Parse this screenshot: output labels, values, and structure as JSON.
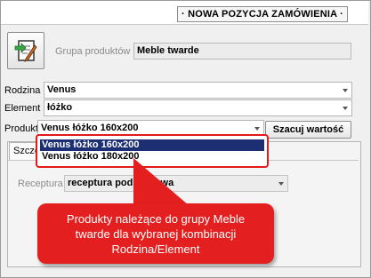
{
  "header": {
    "title_button_label": "· NOWA POZYCJA ZAMÓWIENIA ·"
  },
  "form": {
    "edit_icon_name": "edit-document-icon",
    "grupa_label": "Grupa produktów",
    "grupa_value": "Meble twarde",
    "rodzina_label": "Rodzina",
    "rodzina_value": "Venus",
    "element_label": "Element",
    "element_value": "łóżko",
    "produkt_label": "Produkt",
    "produkt_value": "Venus łóżko 160x200",
    "szacuj_button_label": "Szacuj wartość"
  },
  "dropdown": {
    "options": [
      {
        "label": "Venus łóżko 160x200",
        "selected": true
      },
      {
        "label": "Venus łóżko 180x200",
        "selected": false
      }
    ]
  },
  "tabs": {
    "active_tab_label": "Szczegóły",
    "receptura_label": "Receptura",
    "receptura_value": "receptura podstawowa"
  },
  "callout": {
    "text": "Produkty należące do grupy Meble twarde dla wybranej kombinacji Rodzina/Element"
  },
  "colors": {
    "highlight_red": "#e41f1f",
    "selection_blue": "#1c2f73"
  }
}
